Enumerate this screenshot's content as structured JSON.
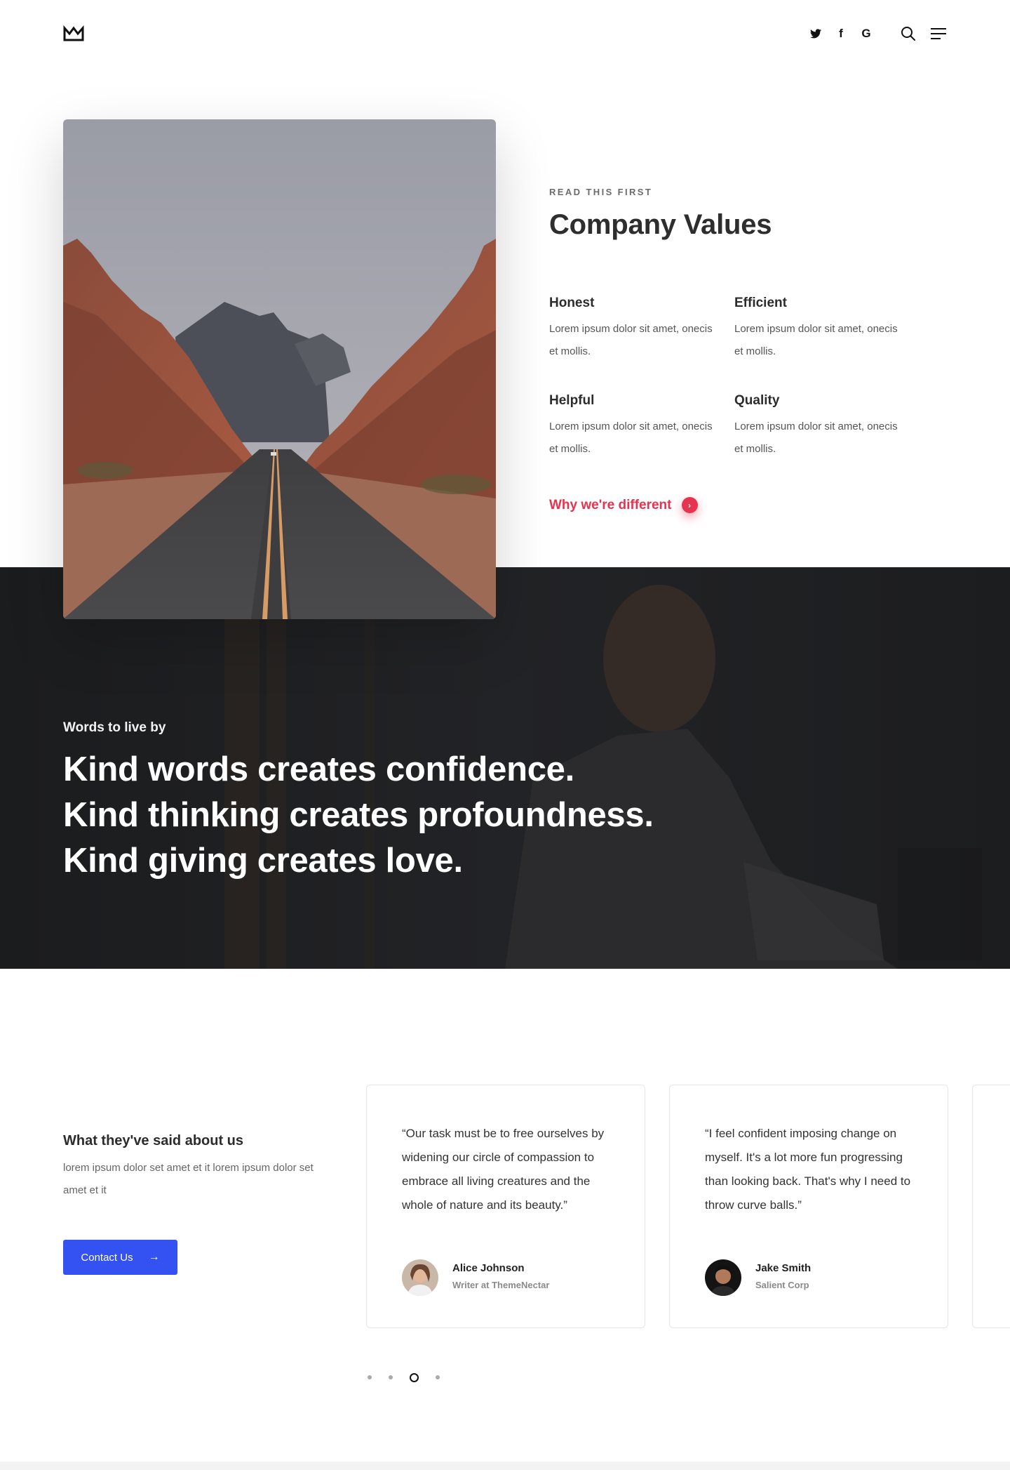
{
  "header": {
    "logo_icon": "crown-icon",
    "social": [
      {
        "name": "twitter-icon",
        "glyph": ""
      },
      {
        "name": "facebook-icon",
        "glyph": "f"
      },
      {
        "name": "google-icon",
        "glyph": "G"
      }
    ],
    "search_icon": "search-icon",
    "menu_icon": "menu-icon"
  },
  "values": {
    "eyebrow": "READ THIS FIRST",
    "title": "Company Values",
    "items": [
      {
        "title": "Honest",
        "text": "Lorem ipsum dolor sit amet, onecis et mollis."
      },
      {
        "title": "Efficient",
        "text": "Lorem ipsum dolor sit amet, onecis et mollis."
      },
      {
        "title": "Helpful",
        "text": "Lorem ipsum dolor sit amet, onecis et mollis."
      },
      {
        "title": "Quality",
        "text": "Lorem ipsum dolor sit amet, onecis et mollis."
      }
    ],
    "link_label": "Why we're different",
    "link_icon": "chevron-right-icon"
  },
  "quote": {
    "eyebrow": "Words to live by",
    "lines": [
      "Kind words creates confidence.",
      "Kind thinking creates profoundness.",
      "Kind giving creates love."
    ]
  },
  "testimonials": {
    "title": "What they've said about us",
    "description": "lorem ipsum dolor set amet et it lorem ipsum dolor set amet et it",
    "button_label": "Contact Us",
    "button_icon": "arrow-right-icon",
    "cards": [
      {
        "quote": "“Our task must be to free ourselves by widening our circle of compassion to embrace all living creatures and the whole of nature and its beauty.”",
        "name": "Alice Johnson",
        "role": "Writer at ThemeNectar"
      },
      {
        "quote": "“I feel confident imposing change on myself. It's a lot more fun progressing than looking back. That's why I need to throw curve balls.”",
        "name": "Jake Smith",
        "role": "Salient Corp"
      }
    ],
    "dots": {
      "count": 4,
      "active_index": 2
    }
  },
  "colors": {
    "accent": "#e6334f",
    "button": "#3452f2",
    "dark_band": "#1d1e20"
  }
}
